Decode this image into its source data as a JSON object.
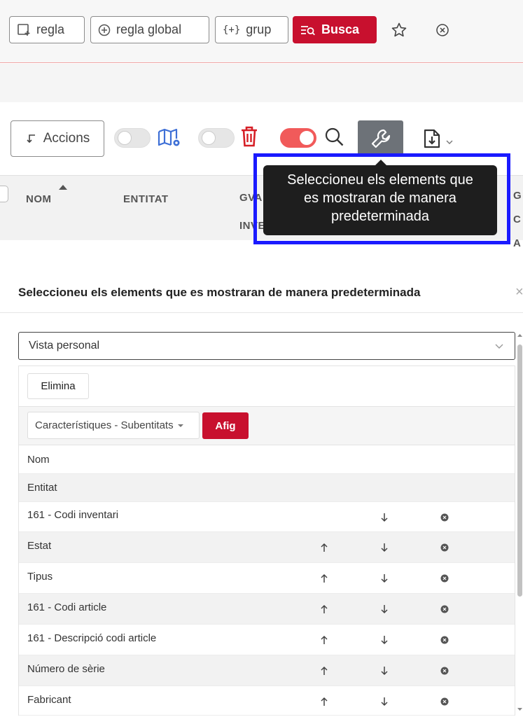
{
  "toolbar": {
    "regla_label": "regla",
    "regla_global_label": "regla global",
    "grup_label": "grup",
    "busca_label": "Busca"
  },
  "actions": {
    "accions_label": "Accions"
  },
  "table_header": {
    "col_nom": "NOM",
    "col_entitat": "ENTITAT",
    "col_gva_line1": "GVA - CODI",
    "col_gva_line2": "INVENTARI",
    "col_g_line1": "G",
    "col_g_line2": "C",
    "col_g_line3": "A"
  },
  "tooltip": {
    "text_line1": "Seleccioneu els elements que",
    "text_line2": "es mostraran de manera",
    "text_line3": "predeterminada"
  },
  "modal": {
    "title": "Seleccioneu els elements que es mostraran de manera predeterminada",
    "close_glyph": "×",
    "view_select_value": "Vista personal",
    "delete_label": "Elimina",
    "sub_select_value": "Característiques - Subentitats",
    "add_label": "Afig",
    "rows": [
      {
        "label": "Nom"
      },
      {
        "label": "Entitat"
      },
      {
        "label": "161 - Codi inventari"
      },
      {
        "label": "Estat"
      },
      {
        "label": "Tipus"
      },
      {
        "label": "161 - Codi article"
      },
      {
        "label": "161 - Descripció codi article"
      },
      {
        "label": "Número de sèrie"
      },
      {
        "label": "Fabricant"
      }
    ]
  },
  "colors": {
    "accent_red": "#c8102e",
    "toggle_on": "#f15a5a",
    "tooltip_bg": "#1e1e1e",
    "highlight_frame": "#1a1aff"
  },
  "icons": [
    "add-rule-icon",
    "plus-circle-icon",
    "braces-icon",
    "filter-search-icon",
    "star-icon",
    "close-circle-icon",
    "return-arrow-icon",
    "map-icon",
    "trash-icon",
    "search-icon",
    "wrench-icon",
    "download-file-icon",
    "chevron-down-icon",
    "sort-asc-icon",
    "arrow-up-icon",
    "arrow-down-icon",
    "remove-icon"
  ]
}
